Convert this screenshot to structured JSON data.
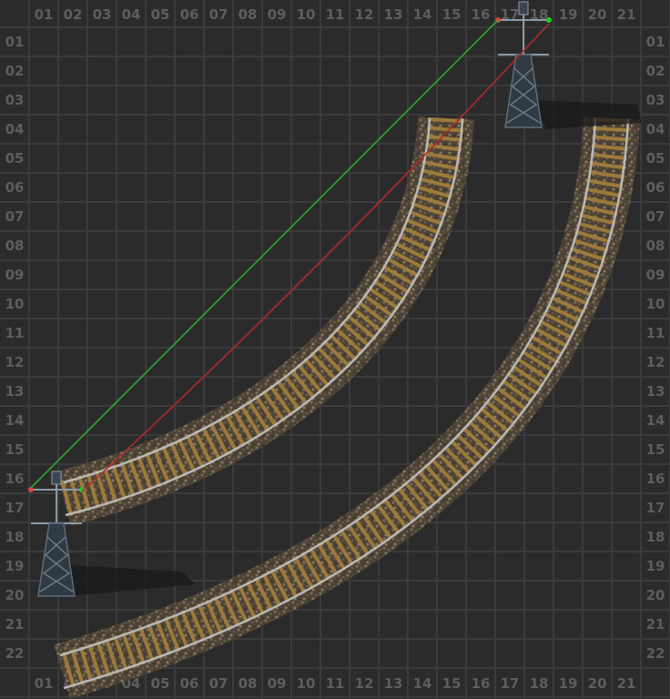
{
  "grid": {
    "columns": [
      "01",
      "02",
      "03",
      "04",
      "05",
      "06",
      "07",
      "08",
      "09",
      "10",
      "11",
      "12",
      "13",
      "14",
      "15",
      "16",
      "17",
      "18",
      "19",
      "20",
      "21"
    ],
    "rows": [
      "01",
      "02",
      "03",
      "04",
      "05",
      "06",
      "07",
      "08",
      "09",
      "10",
      "11",
      "12",
      "13",
      "14",
      "15",
      "16",
      "17",
      "18",
      "19",
      "20",
      "21",
      "22"
    ]
  },
  "colors": {
    "background": "#2b2b2b",
    "grid_line": "#3b3b3b",
    "label": "#5e5e5e",
    "green_wire": "#2fa52f",
    "red_wire": "#b52a2a",
    "rail_sleeper": "#9c7a3a",
    "rail_steel": "#b8b8b8",
    "ballast": "#5b4f3f"
  },
  "entities": {
    "top_pole": "big-electric-pole",
    "bottom_pole": "big-electric-pole",
    "rail_a": "curved-rail",
    "rail_b": "curved-rail",
    "wires": [
      "green-circuit-wire",
      "red-circuit-wire"
    ]
  }
}
